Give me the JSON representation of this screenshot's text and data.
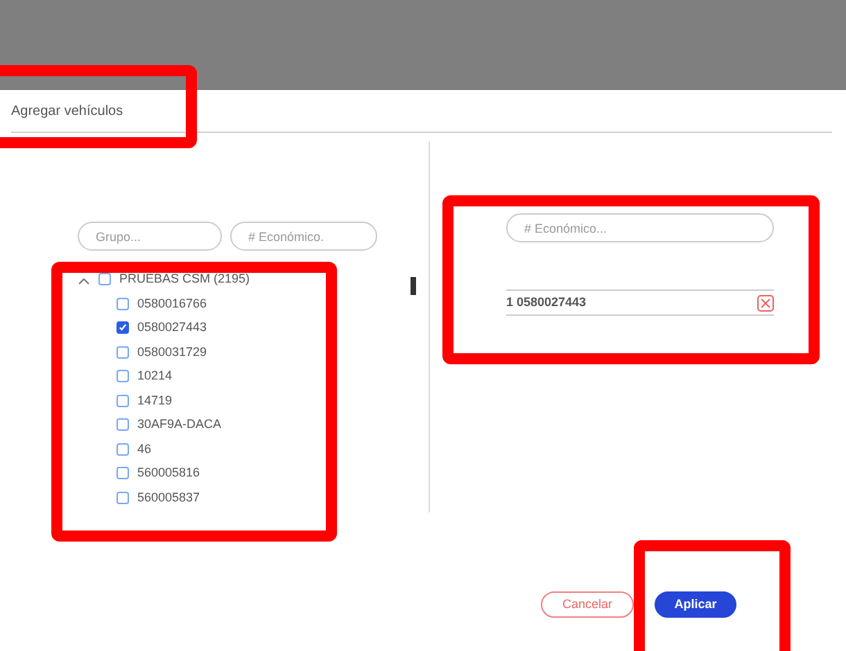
{
  "dialog": {
    "title": "Agregar vehículos"
  },
  "filters": [
    {
      "placeholder": "Grupo..."
    },
    {
      "placeholder": "# Económico."
    }
  ],
  "tree": [
    {
      "label": "PRUEBAS CSM (2195)",
      "expanded": true,
      "checked": false,
      "children": [
        {
          "label": "0580016766",
          "checked": false
        },
        {
          "label": "0580027443",
          "checked": true
        },
        {
          "label": "0580031729",
          "checked": false
        },
        {
          "label": "10214",
          "checked": false
        },
        {
          "label": "14719",
          "checked": false
        },
        {
          "label": "30AF9A-DACA",
          "checked": false
        },
        {
          "label": "46",
          "checked": false
        },
        {
          "label": "560005816",
          "checked": false
        },
        {
          "label": "560005837",
          "checked": false
        }
      ]
    }
  ],
  "selected_panel": {
    "search": {
      "placeholder": "# Económico..."
    },
    "items": [
      {
        "label": "1 0580027443"
      }
    ]
  },
  "buttons": [
    {
      "kind": "secondary",
      "label": "Cancelar"
    },
    {
      "kind": "primary",
      "label": "Aplicar"
    }
  ]
}
